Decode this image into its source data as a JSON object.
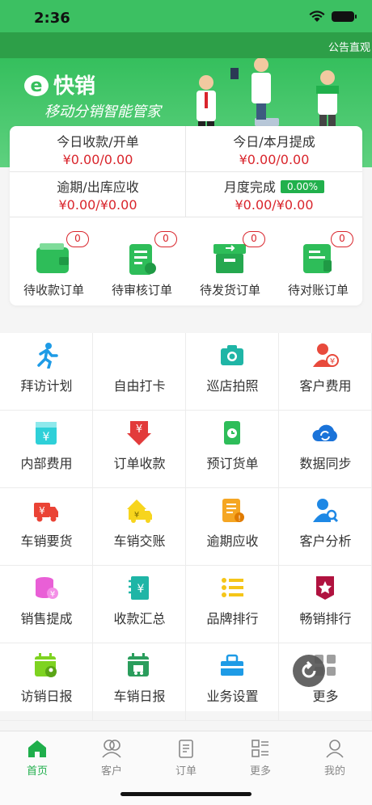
{
  "status": {
    "time": "2:36"
  },
  "notice": {
    "text": "公告直观"
  },
  "banner": {
    "logo_letter": "e",
    "logo_name": "快销",
    "slogan": "移动分销智能管家"
  },
  "stats": [
    {
      "label": "今日收款/开单",
      "value": "¥0.00/0.00"
    },
    {
      "label": "今日/本月提成",
      "value": "¥0.00/0.00"
    },
    {
      "label": "逾期/出库应收",
      "value": "¥0.00/¥0.00"
    },
    {
      "label": "月度完成",
      "badge": "0.00%",
      "value": "¥0.00/¥0.00"
    }
  ],
  "orders": [
    {
      "label": "待收款订单",
      "count": "0",
      "icon": "wallet-icon"
    },
    {
      "label": "待审核订单",
      "count": "0",
      "icon": "document-icon"
    },
    {
      "label": "待发货订单",
      "count": "0",
      "icon": "shipping-box-icon"
    },
    {
      "label": "待对账订单",
      "count": "0",
      "icon": "ledger-icon"
    }
  ],
  "grid": [
    {
      "label": "拜访计划",
      "icon": "running-person-icon",
      "color": "#1e9be6"
    },
    {
      "label": "自由打卡",
      "icon": "location-check-icon",
      "color": "#f5a623"
    },
    {
      "label": "巡店拍照",
      "icon": "camera-icon",
      "color": "#1fb5a6"
    },
    {
      "label": "客户费用",
      "icon": "customer-yen-icon",
      "color": "#e84a3c"
    },
    {
      "label": "内部费用",
      "icon": "internal-yen-icon",
      "color": "#2ed0d8"
    },
    {
      "label": "订单收款",
      "icon": "yen-download-icon",
      "color": "#e23b3b"
    },
    {
      "label": "预订货单",
      "icon": "clock-document-icon",
      "color": "#2ebd59"
    },
    {
      "label": "数据同步",
      "icon": "cloud-sync-icon",
      "color": "#1a73d9"
    },
    {
      "label": "车销要货",
      "icon": "truck-yen-icon",
      "color": "#ea4335"
    },
    {
      "label": "车销交账",
      "icon": "yen-truck-handover-icon",
      "color": "#f7d51d"
    },
    {
      "label": "逾期应收",
      "icon": "overdue-document-icon",
      "color": "#f5a623"
    },
    {
      "label": "客户分析",
      "icon": "user-search-icon",
      "color": "#1e88e5"
    },
    {
      "label": "销售提成",
      "icon": "coins-stack-icon",
      "color": "#e95fd6"
    },
    {
      "label": "收款汇总",
      "icon": "notebook-yen-icon",
      "color": "#1fb5a6"
    },
    {
      "label": "品牌排行",
      "icon": "ranking-list-icon",
      "color": "#f5c518"
    },
    {
      "label": "畅销排行",
      "icon": "star-badge-icon",
      "color": "#b0123f"
    },
    {
      "label": "访销日报",
      "icon": "calendar-user-icon",
      "color": "#7ed321"
    },
    {
      "label": "车销日报",
      "icon": "calendar-truck-icon",
      "color": "#2a9d5c"
    },
    {
      "label": "业务设置",
      "icon": "toolbox-icon",
      "color": "#1e9be6"
    },
    {
      "label": "更多",
      "icon": "more-grid-icon",
      "color": "#9e9e9e"
    }
  ],
  "tabs": [
    {
      "label": "首页",
      "icon": "home-icon",
      "active": true
    },
    {
      "label": "客户",
      "icon": "customers-icon",
      "active": false
    },
    {
      "label": "订单",
      "icon": "order-icon",
      "active": false
    },
    {
      "label": "更多",
      "icon": "more-list-icon",
      "active": false
    },
    {
      "label": "我的",
      "icon": "profile-icon",
      "active": false
    }
  ],
  "colors": {
    "brand_green": "#3cc062",
    "accent_red": "#d9252c",
    "tab_active": "#1fae4b"
  }
}
